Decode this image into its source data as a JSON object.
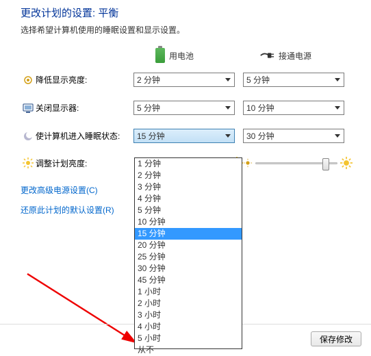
{
  "title": "更改计划的设置: 平衡",
  "subtitle": "选择希望计算机使用的睡眠设置和显示设置。",
  "header": {
    "battery": "用电池",
    "ac": "接通电源"
  },
  "rows": {
    "dim": {
      "label": "降低显示亮度:",
      "battery": "2 分钟",
      "ac": "5 分钟"
    },
    "display": {
      "label": "关闭显示器:",
      "battery": "5 分钟",
      "ac": "10 分钟"
    },
    "sleep": {
      "label": "使计算机进入睡眠状态:",
      "battery": "15 分钟",
      "ac": "30 分钟"
    },
    "brightness": {
      "label": "调整计划亮度:"
    }
  },
  "links": {
    "advanced": "更改高级电源设置(C)",
    "restore": "还原此计划的默认设置(R)"
  },
  "dropdown_options": [
    "1 分钟",
    "2 分钟",
    "3 分钟",
    "4 分钟",
    "5 分钟",
    "10 分钟",
    "15 分钟",
    "20 分钟",
    "25 分钟",
    "30 分钟",
    "45 分钟",
    "1 小时",
    "2 小时",
    "3 小时",
    "4 小时",
    "5 小时",
    "从不"
  ],
  "dropdown_selected": "15 分钟",
  "buttons": {
    "save": "保存修改"
  },
  "colors": {
    "link": "#0066cc",
    "title": "#003399",
    "highlight": "#3399ff"
  }
}
